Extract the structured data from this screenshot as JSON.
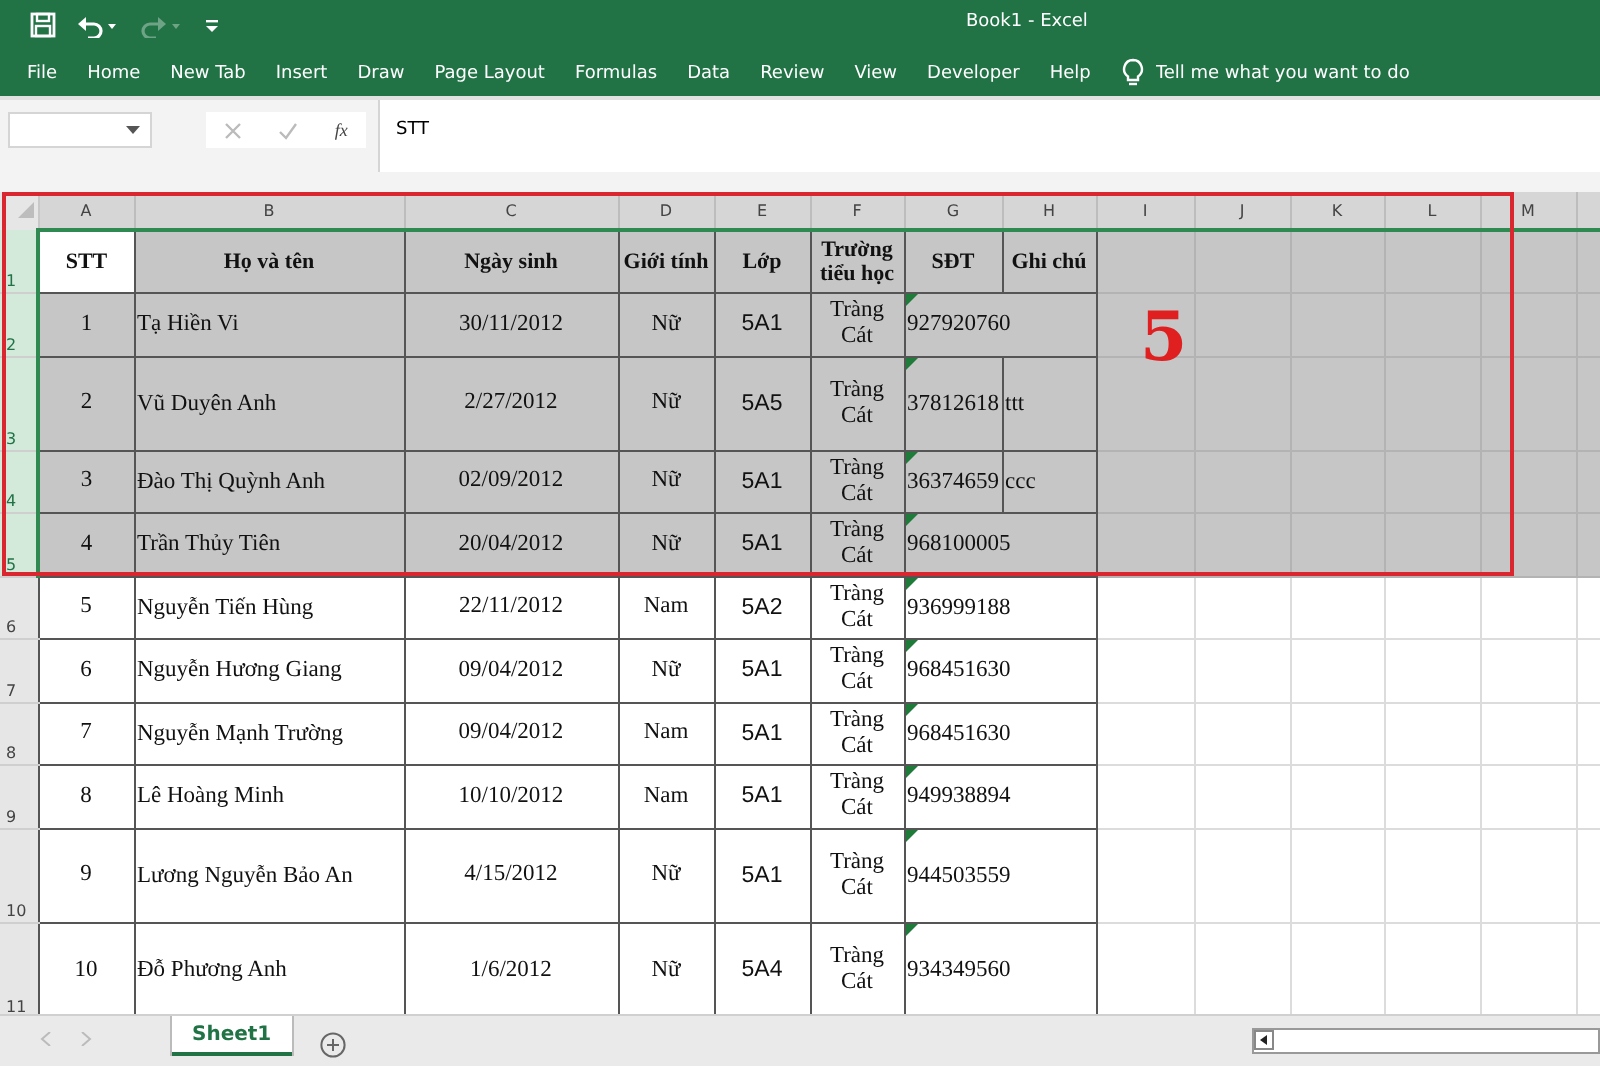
{
  "window": {
    "title": "Book1  -  Excel"
  },
  "ribbon_tabs": [
    {
      "label": "File"
    },
    {
      "label": "Home"
    },
    {
      "label": "New Tab"
    },
    {
      "label": "Insert"
    },
    {
      "label": "Draw"
    },
    {
      "label": "Page Layout"
    },
    {
      "label": "Formulas"
    },
    {
      "label": "Data"
    },
    {
      "label": "Review"
    },
    {
      "label": "View"
    },
    {
      "label": "Developer"
    },
    {
      "label": "Help"
    }
  ],
  "tell_me": {
    "placeholder": "Tell me what you want to do"
  },
  "formula_bar": {
    "function_label": "fx",
    "value": "STT"
  },
  "columns": [
    "A",
    "B",
    "C",
    "D",
    "E",
    "F",
    "G",
    "H",
    "I",
    "J",
    "K",
    "L",
    "M"
  ],
  "rows": [
    {
      "number": "1",
      "selected": true,
      "cells": [
        {
          "text": "STT",
          "kind": "header",
          "active": true
        },
        {
          "text": "Họ và tên",
          "kind": "header"
        },
        {
          "text": "Ngày sinh",
          "kind": "header"
        },
        {
          "text": "Giới tính",
          "kind": "header"
        },
        {
          "text": "Lớp",
          "kind": "header"
        },
        {
          "text": "Trường tiểu học",
          "kind": "header"
        },
        {
          "text": "SĐT",
          "kind": "header"
        },
        {
          "text": "Ghi chú",
          "kind": "header"
        }
      ]
    },
    {
      "number": "2",
      "selected": true,
      "cells": [
        {
          "text": "1",
          "kind": "center"
        },
        {
          "text": "Tạ Hiền  Vi",
          "kind": "left"
        },
        {
          "text": "30/11/2012",
          "kind": "center"
        },
        {
          "text": "Nữ",
          "kind": "center"
        },
        {
          "text": "5A1",
          "kind": "sans"
        },
        {
          "text": "Tràng Cát",
          "kind": "center"
        },
        {
          "text": "927920760",
          "kind": "left",
          "flag": true
        }
      ]
    },
    {
      "number": "3",
      "selected": true,
      "cells": [
        {
          "text": "2",
          "kind": "center"
        },
        {
          "text": "Vũ Duyên Anh",
          "kind": "left"
        },
        {
          "text": "2/27/2012",
          "kind": "center"
        },
        {
          "text": "Nữ",
          "kind": "center"
        },
        {
          "text": "5A5",
          "kind": "sans"
        },
        {
          "text": "Tràng Cát",
          "kind": "center"
        },
        {
          "text": "37812618",
          "kind": "left",
          "flag": true
        },
        {
          "text": "ttt",
          "kind": "left"
        }
      ]
    },
    {
      "number": "4",
      "selected": true,
      "cells": [
        {
          "text": "3",
          "kind": "center"
        },
        {
          "text": "Đào Thị Quỳnh  Anh",
          "kind": "left"
        },
        {
          "text": "02/09/2012",
          "kind": "center"
        },
        {
          "text": "Nữ",
          "kind": "center"
        },
        {
          "text": "5A1",
          "kind": "sans"
        },
        {
          "text": "Tràng Cát",
          "kind": "center"
        },
        {
          "text": "36374659",
          "kind": "left",
          "flag": true
        },
        {
          "text": "ccc",
          "kind": "left"
        }
      ]
    },
    {
      "number": "5",
      "selected": true,
      "cells": [
        {
          "text": "4",
          "kind": "center"
        },
        {
          "text": "Trần Thủy  Tiên",
          "kind": "left"
        },
        {
          "text": "20/04/2012",
          "kind": "center"
        },
        {
          "text": "Nữ",
          "kind": "center"
        },
        {
          "text": "5A1",
          "kind": "sans"
        },
        {
          "text": "Tràng Cát",
          "kind": "center"
        },
        {
          "text": "968100005",
          "kind": "left",
          "flag": true
        }
      ]
    },
    {
      "number": "6",
      "selected": false,
      "cells": [
        {
          "text": "5",
          "kind": "center"
        },
        {
          "text": "Nguyễn Tiến  Hùng",
          "kind": "left"
        },
        {
          "text": "22/11/2012",
          "kind": "center"
        },
        {
          "text": "Nam",
          "kind": "center"
        },
        {
          "text": "5A2",
          "kind": "sans"
        },
        {
          "text": "Tràng Cát",
          "kind": "center"
        },
        {
          "text": "936999188",
          "kind": "left",
          "flag": true
        }
      ]
    },
    {
      "number": "7",
      "selected": false,
      "cells": [
        {
          "text": "6",
          "kind": "center"
        },
        {
          "text": "Nguyễn  Hương  Giang",
          "kind": "left"
        },
        {
          "text": "09/04/2012",
          "kind": "center"
        },
        {
          "text": "Nữ",
          "kind": "center"
        },
        {
          "text": "5A1",
          "kind": "sans"
        },
        {
          "text": "Tràng Cát",
          "kind": "center"
        },
        {
          "text": "968451630",
          "kind": "left",
          "flag": true
        }
      ]
    },
    {
      "number": "8",
      "selected": false,
      "cells": [
        {
          "text": "7",
          "kind": "center"
        },
        {
          "text": "Nguyễn Mạnh  Trường",
          "kind": "left"
        },
        {
          "text": "09/04/2012",
          "kind": "center"
        },
        {
          "text": "Nam",
          "kind": "center"
        },
        {
          "text": "5A1",
          "kind": "sans"
        },
        {
          "text": "Tràng Cát",
          "kind": "center"
        },
        {
          "text": "968451630",
          "kind": "left",
          "flag": true
        }
      ]
    },
    {
      "number": "9",
      "selected": false,
      "cells": [
        {
          "text": "8",
          "kind": "center"
        },
        {
          "text": "Lê Hoàng  Minh",
          "kind": "left"
        },
        {
          "text": "10/10/2012",
          "kind": "center"
        },
        {
          "text": "Nam",
          "kind": "center"
        },
        {
          "text": "5A1",
          "kind": "sans"
        },
        {
          "text": "Tràng Cát",
          "kind": "center"
        },
        {
          "text": "949938894",
          "kind": "left",
          "flag": true
        }
      ]
    },
    {
      "number": "10",
      "selected": false,
      "cells": [
        {
          "text": "9",
          "kind": "center"
        },
        {
          "text": "Lương Nguyễn Bảo An",
          "kind": "left"
        },
        {
          "text": "4/15/2012",
          "kind": "center"
        },
        {
          "text": "Nữ",
          "kind": "center"
        },
        {
          "text": "5A1",
          "kind": "sans"
        },
        {
          "text": "Tràng Cát",
          "kind": "center"
        },
        {
          "text": "944503559",
          "kind": "left",
          "flag": true
        }
      ]
    },
    {
      "number": "11",
      "selected": false,
      "cells": [
        {
          "text": "10",
          "kind": "center"
        },
        {
          "text": "Đỗ Phương Anh",
          "kind": "left"
        },
        {
          "text": "1/6/2012",
          "kind": "center"
        },
        {
          "text": "Nữ",
          "kind": "center"
        },
        {
          "text": "5A4",
          "kind": "sans"
        },
        {
          "text": "Tràng Cát",
          "kind": "center"
        },
        {
          "text": "934349560",
          "kind": "left",
          "flag": true
        }
      ]
    }
  ],
  "annotation": {
    "label": "5"
  },
  "sheet_tabs": [
    {
      "label": "Sheet1",
      "selected": true
    }
  ]
}
